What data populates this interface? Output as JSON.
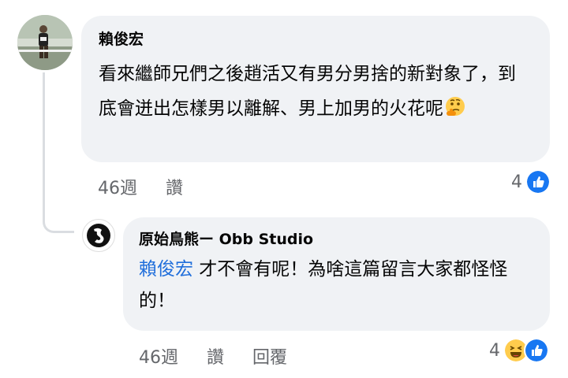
{
  "comment1": {
    "author": "賴俊宏",
    "text": "看來繼師兄們之後趙活又有男分男捨的新對象了，到底會迸出怎樣男以離解、男上加男的火花呢",
    "time": "46週",
    "like_label": "讚",
    "reaction_count": "4",
    "emoji": "thinking-face-icon",
    "reactions": [
      "like-reaction-icon"
    ]
  },
  "reply1": {
    "author": "原始鳥熊ー Obb Studio",
    "mention": "賴俊宏",
    "text": " 才不會有呢！為啥這篇留言大家都怪怪的！",
    "time": "46週",
    "like_label": "讚",
    "reply_label": "回覆",
    "reaction_count": "4",
    "reactions": [
      "haha-reaction-icon",
      "like-reaction-icon"
    ]
  },
  "colors": {
    "bubble": "#f0f2f5",
    "mention": "#216fdb",
    "meta": "#65676b",
    "like_blue": "#1877f2"
  }
}
